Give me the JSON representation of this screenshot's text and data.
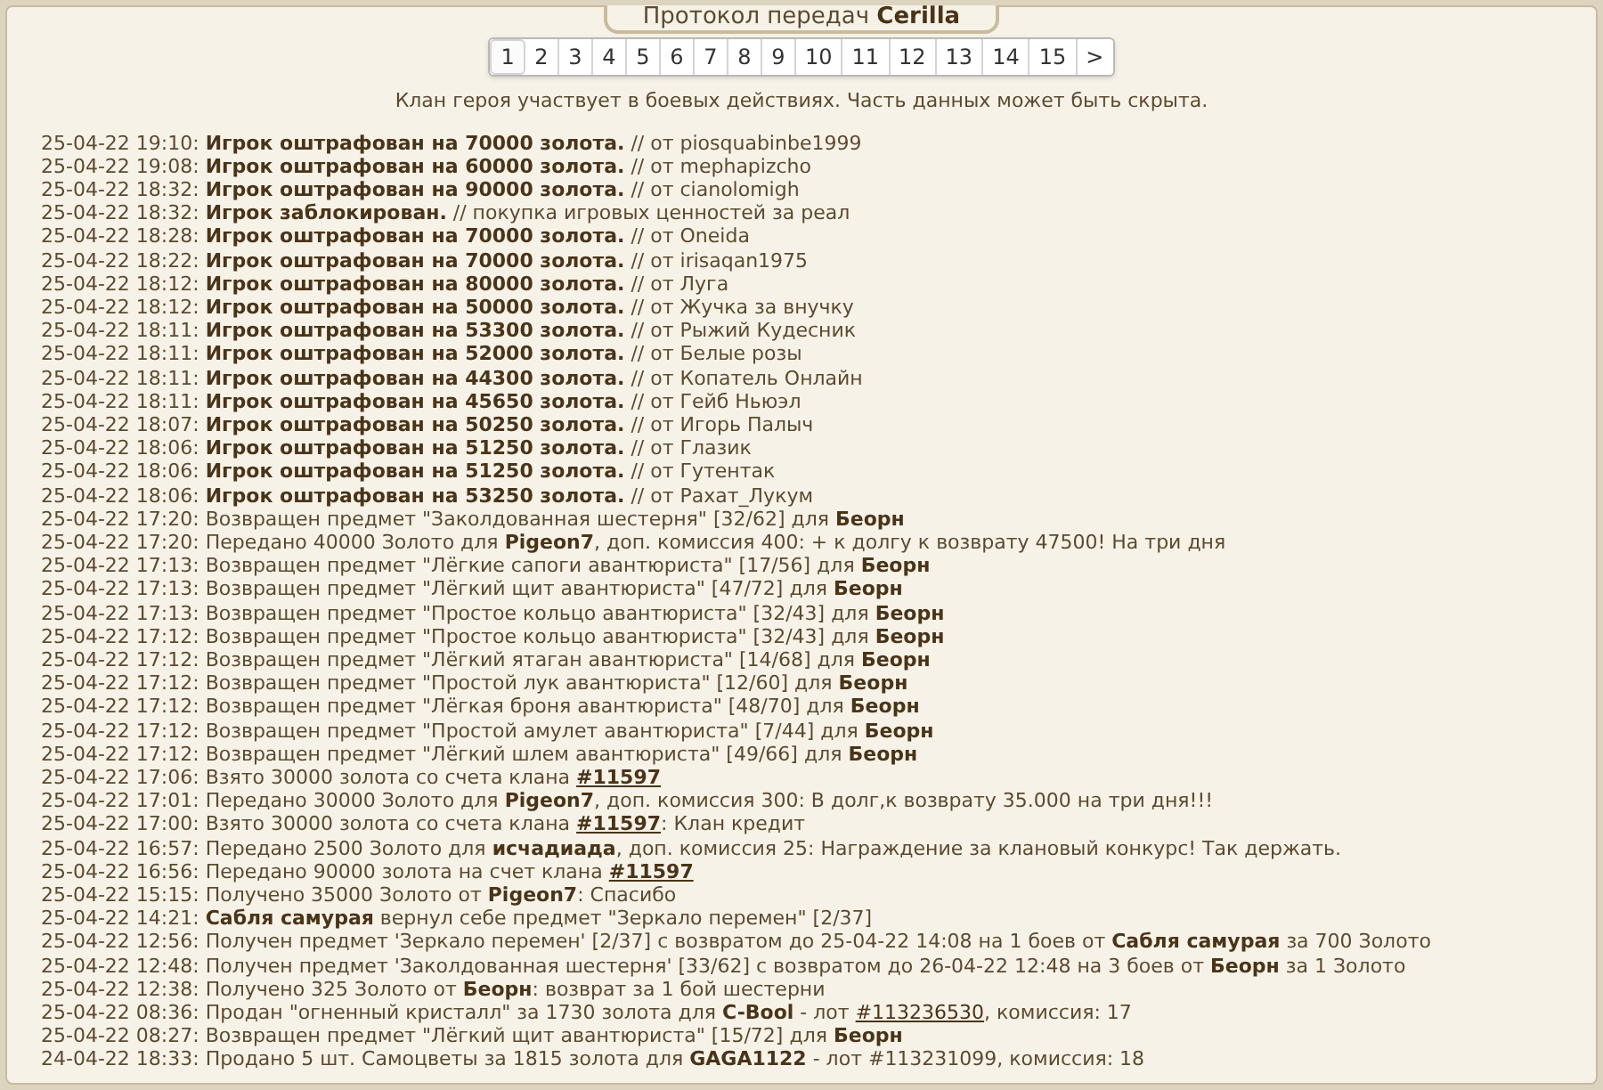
{
  "title": {
    "prefix": "Протокол передач",
    "name": "Cerilla"
  },
  "pager": [
    {
      "label": "1",
      "selected": true
    },
    {
      "label": "2",
      "selected": false
    },
    {
      "label": "3",
      "selected": false
    },
    {
      "label": "4",
      "selected": false
    },
    {
      "label": "5",
      "selected": false
    },
    {
      "label": "6",
      "selected": false
    },
    {
      "label": "7",
      "selected": false
    },
    {
      "label": "8",
      "selected": false
    },
    {
      "label": "9",
      "selected": false
    },
    {
      "label": "10",
      "selected": false
    },
    {
      "label": "11",
      "selected": false
    },
    {
      "label": "12",
      "selected": false
    },
    {
      "label": "13",
      "selected": false
    },
    {
      "label": "14",
      "selected": false
    },
    {
      "label": "15",
      "selected": false
    },
    {
      "label": ">",
      "selected": false
    }
  ],
  "notice": "Клан героя участвует в боевых действиях. Часть данных может быть скрыта.",
  "log": [
    {
      "segments": [
        {
          "kind": "text",
          "text": "25-04-22 19:10: **Игрок оштрафован на 70000 золота.** // от piosquabinbe1999"
        }
      ]
    },
    {
      "segments": [
        {
          "kind": "text",
          "text": "25-04-22 19:08: **Игрок оштрафован на 60000 золота.** // от mephapizcho"
        }
      ]
    },
    {
      "segments": [
        {
          "kind": "text",
          "text": "25-04-22 18:32: **Игрок оштрафован на 90000 золота.** // от cianolomigh"
        }
      ]
    },
    {
      "segments": [
        {
          "kind": "text",
          "text": "25-04-22 18:32: **Игрок заблокирован.** // покупка игровых ценностей за реал"
        }
      ]
    },
    {
      "segments": [
        {
          "kind": "text",
          "text": "25-04-22 18:28: **Игрок оштрафован на 70000 золота.** // от Oneida"
        }
      ]
    },
    {
      "segments": [
        {
          "kind": "text",
          "text": "25-04-22 18:22: **Игрок оштрафован на 70000 золота.** // от irisaqan1975"
        }
      ]
    },
    {
      "segments": [
        {
          "kind": "text",
          "text": "25-04-22 18:12: **Игрок оштрафован на 80000 золота.** // от Луга"
        }
      ]
    },
    {
      "segments": [
        {
          "kind": "text",
          "text": "25-04-22 18:12: **Игрок оштрафован на 50000 золота.** // от Жучка за внучку"
        }
      ]
    },
    {
      "segments": [
        {
          "kind": "text",
          "text": "25-04-22 18:11: **Игрок оштрафован на 53300 золота.** // от Рыжий Кудесник"
        }
      ]
    },
    {
      "segments": [
        {
          "kind": "text",
          "text": "25-04-22 18:11: **Игрок оштрафован на 52000 золота.** // от Белые розы"
        }
      ]
    },
    {
      "segments": [
        {
          "kind": "text",
          "text": "25-04-22 18:11: **Игрок оштрафован на 44300 золота.** // от Копатель Онлайн"
        }
      ]
    },
    {
      "segments": [
        {
          "kind": "text",
          "text": "25-04-22 18:11: **Игрок оштрафован на 45650 золота.** // от Гейб Ньюэл"
        }
      ]
    },
    {
      "segments": [
        {
          "kind": "text",
          "text": "25-04-22 18:07: **Игрок оштрафован на 50250 золота.** // от Игорь Палыч"
        }
      ]
    },
    {
      "segments": [
        {
          "kind": "text",
          "text": "25-04-22 18:06: **Игрок оштрафован на 51250 золота.** // от Глазик"
        }
      ]
    },
    {
      "segments": [
        {
          "kind": "text",
          "text": "25-04-22 18:06: **Игрок оштрафован на 51250 золота.** // от Гутентак"
        }
      ]
    },
    {
      "segments": [
        {
          "kind": "text",
          "text": "25-04-22 18:06: **Игрок оштрафован на 53250 золота.** // от Рахат_Лукум"
        }
      ]
    },
    {
      "segments": [
        {
          "kind": "text",
          "text": "25-04-22 17:20: Возвращен предмет \"Заколдованная шестерня\" [32/62] для **Беорн**"
        }
      ]
    },
    {
      "segments": [
        {
          "kind": "text",
          "text": "25-04-22 17:20: Передано 40000 Золото для **Pigeon7**, доп. комиссия 400: + к долгу к возврату 47500! На три дня"
        }
      ]
    },
    {
      "segments": [
        {
          "kind": "text",
          "text": "25-04-22 17:13: Возвращен предмет \"Лёгкие сапоги авантюриста\" [17/56] для **Беорн**"
        }
      ]
    },
    {
      "segments": [
        {
          "kind": "text",
          "text": "25-04-22 17:13: Возвращен предмет \"Лёгкий щит авантюриста\" [47/72] для **Беорн**"
        }
      ]
    },
    {
      "segments": [
        {
          "kind": "text",
          "text": "25-04-22 17:13: Возвращен предмет \"Простое кольцо авантюриста\" [32/43] для **Беорн**"
        }
      ]
    },
    {
      "segments": [
        {
          "kind": "text",
          "text": "25-04-22 17:12: Возвращен предмет \"Простое кольцо авантюриста\" [32/43] для **Беорн**"
        }
      ]
    },
    {
      "segments": [
        {
          "kind": "text",
          "text": "25-04-22 17:12: Возвращен предмет \"Лёгкий ятаган авантюриста\" [14/68] для **Беорн**"
        }
      ]
    },
    {
      "segments": [
        {
          "kind": "text",
          "text": "25-04-22 17:12: Возвращен предмет \"Простой лук авантюриста\" [12/60] для **Беорн**"
        }
      ]
    },
    {
      "segments": [
        {
          "kind": "text",
          "text": "25-04-22 17:12: Возвращен предмет \"Лёгкая броня авантюриста\" [48/70] для **Беорн**"
        }
      ]
    },
    {
      "segments": [
        {
          "kind": "text",
          "text": "25-04-22 17:12: Возвращен предмет \"Простой амулет авантюриста\" [7/44] для **Беорн**"
        }
      ]
    },
    {
      "segments": [
        {
          "kind": "text",
          "text": "25-04-22 17:12: Возвращен предмет \"Лёгкий шлем авантюриста\" [49/66] для **Беорн**"
        }
      ]
    },
    {
      "segments": [
        {
          "kind": "text",
          "text": "25-04-22 17:06: Взято 30000 золота со счета клана "
        },
        {
          "kind": "link",
          "text": "#11597",
          "bold": true
        }
      ]
    },
    {
      "segments": [
        {
          "kind": "text",
          "text": "25-04-22 17:01: Передано 30000 Золото для **Pigeon7**, доп. комиссия 300: В долг,к возврату 35.000 на три дня!!!"
        }
      ]
    },
    {
      "segments": [
        {
          "kind": "text",
          "text": "25-04-22 17:00: Взято 30000 золота со счета клана "
        },
        {
          "kind": "link",
          "text": "#11597",
          "bold": true
        },
        {
          "kind": "text",
          "text": ": Клан кредит"
        }
      ]
    },
    {
      "segments": [
        {
          "kind": "text",
          "text": "25-04-22 16:57: Передано 2500 Золото для **исчадиада**, доп. комиссия 25: Награждение за клановый конкурс! Так держать."
        }
      ]
    },
    {
      "segments": [
        {
          "kind": "text",
          "text": "25-04-22 16:56: Передано 90000 золота на счет клана "
        },
        {
          "kind": "link",
          "text": "#11597",
          "bold": true
        }
      ]
    },
    {
      "segments": [
        {
          "kind": "text",
          "text": "25-04-22 15:15: Получено 35000 Золото от **Pigeon7**: Спасибо"
        }
      ]
    },
    {
      "segments": [
        {
          "kind": "text",
          "text": "25-04-22 14:21: **Сабля самурая** вернул себе предмет \"Зеркало перемен\" [2/37]"
        }
      ]
    },
    {
      "segments": [
        {
          "kind": "text",
          "text": "25-04-22 12:56: Получен предмет 'Зеркало перемен' [2/37] с возвратом до 25-04-22 14:08 на 1 боев от **Сабля самурая** за 700 Золото"
        }
      ]
    },
    {
      "segments": [
        {
          "kind": "text",
          "text": "25-04-22 12:48: Получен предмет 'Заколдованная шестерня' [33/62] с возвратом до 26-04-22 12:48 на 3 боев от **Беорн** за 1 Золото"
        }
      ]
    },
    {
      "segments": [
        {
          "kind": "text",
          "text": "25-04-22 12:38: Получено 325 Золото от **Беорн**: возврат за 1 бой шестерни"
        }
      ]
    },
    {
      "segments": [
        {
          "kind": "text",
          "text": "25-04-22 08:36: Продан \"огненный кристалл\" за 1730 золота для **C-Bool** - лот "
        },
        {
          "kind": "link",
          "text": "#113236530",
          "bold": false
        },
        {
          "kind": "text",
          "text": ", комиссия: 17"
        }
      ]
    },
    {
      "segments": [
        {
          "kind": "text",
          "text": "25-04-22 08:27: Возвращен предмет \"Лёгкий щит авантюриста\" [15/72] для **Беорн**"
        }
      ]
    },
    {
      "segments": [
        {
          "kind": "text",
          "text": "24-04-22 18:33: Продано 5 шт. Самоцветы за 1815 золота для **GAGA1122** - лот #113231099, комиссия: 18"
        }
      ]
    }
  ]
}
